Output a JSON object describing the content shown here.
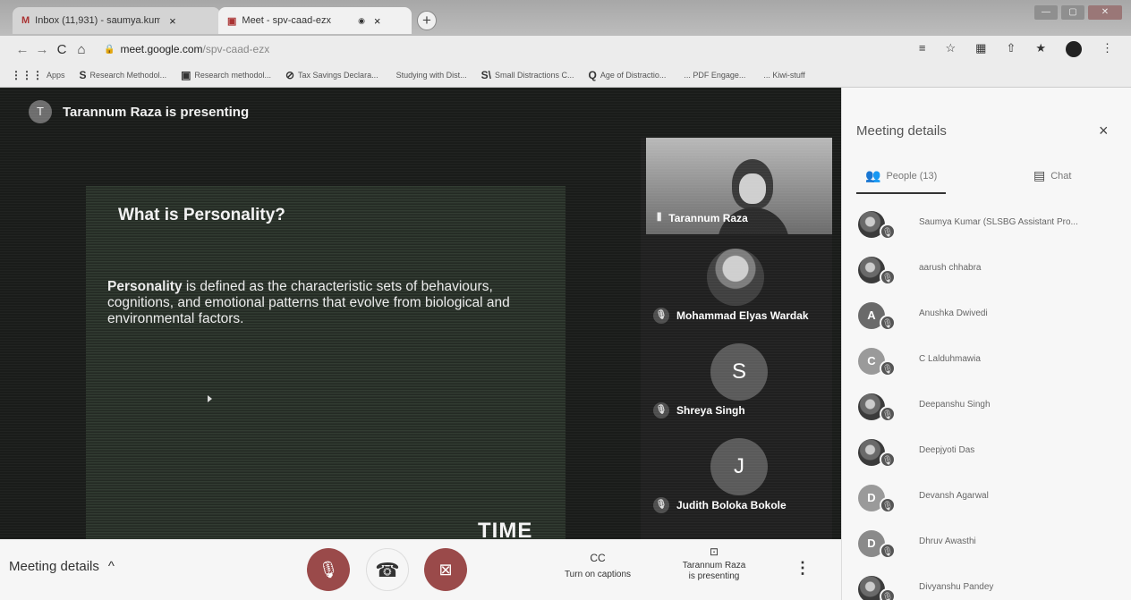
{
  "browser": {
    "tabs": [
      {
        "favicon": "M",
        "title": "Inbox (11,931) - saumya.kumar",
        "close": "×"
      },
      {
        "favicon": "▣",
        "title": "Meet - spv-caad-ezx",
        "record": "◉",
        "close": "×"
      }
    ],
    "new_tab": "+",
    "window_controls": [
      "—",
      "▢",
      "✕"
    ],
    "nav": {
      "back": "←",
      "forward": "→",
      "reload": "C",
      "home": "⌂"
    },
    "url_lock": "🔒",
    "url_host": "meet.google.com",
    "url_path": "/spv-caad-ezx",
    "bookmarks": [
      {
        "icon": "⋮⋮⋮",
        "label": "Apps"
      },
      {
        "icon": "S",
        "label": "Research Methodol..."
      },
      {
        "icon": "▣",
        "label": "Research methodol..."
      },
      {
        "icon": "⊘",
        "label": "Tax Savings Declara..."
      },
      {
        "icon": "",
        "label": "Studying with Dist..."
      },
      {
        "icon": "S\\",
        "label": "Small Distractions C..."
      },
      {
        "icon": "Q",
        "label": "Age of Distractio..."
      },
      {
        "icon": "",
        "label": "... PDF Engage..."
      },
      {
        "icon": "",
        "label": "... Kiwi-stuff"
      }
    ],
    "extension_icons": [
      "≡",
      "☆",
      "▦",
      "⇧",
      "★"
    ],
    "menu": "⋮"
  },
  "presenting": {
    "avatar_letter": "T",
    "text": "Tarannum Raza is presenting"
  },
  "slide": {
    "title": "What is Personality?",
    "body_bold": "Personality",
    "body_rest": " is defined as the characteristic sets of behaviours, cognitions, and emotional patterns that evolve from biological and environmental factors.",
    "footer": "TIME"
  },
  "tiles": [
    {
      "name": "Tarannum Raza",
      "kind": "video",
      "indicator": "⦀"
    },
    {
      "name": "Mohammad Elyas Wardak",
      "kind": "photo",
      "indicator": "🎙"
    },
    {
      "name": "Shreya Singh",
      "kind": "letter",
      "letter": "S",
      "indicator": "🎙"
    },
    {
      "name": "Judith Boloka Bokole",
      "kind": "letter",
      "letter": "J",
      "indicator": "🎙"
    }
  ],
  "controls": {
    "meeting_details": "Meeting details",
    "meeting_details_caret": "^",
    "mic_icon": "🎙",
    "hangup_icon": "☎",
    "camera_icon": "⊠",
    "captions_icon": "CC",
    "captions_label": "Turn on captions",
    "presenting_icon": "⊡",
    "presenting_label_1": "Tarannum Raza",
    "presenting_label_2": "is presenting",
    "more_icon": "⋮"
  },
  "panel": {
    "title": "Meeting details",
    "close": "×",
    "tab_people_icon": "👥",
    "tab_people": "People (13)",
    "tab_chat_icon": "▤",
    "tab_chat": "Chat",
    "participants": [
      {
        "avatar": "photo",
        "letter": "",
        "color": "#777777",
        "name": "Saumya Kumar (SLSBG Assistant Pro..."
      },
      {
        "avatar": "photo",
        "letter": "",
        "color": "#777777",
        "name": "aarush chhabra"
      },
      {
        "avatar": "letter",
        "letter": "A",
        "color": "#6a6a6a",
        "name": "Anushka Dwivedi"
      },
      {
        "avatar": "letter",
        "letter": "C",
        "color": "#9a9a9a",
        "name": "C Lalduhmawia"
      },
      {
        "avatar": "photo",
        "letter": "",
        "color": "#777777",
        "name": "Deepanshu Singh"
      },
      {
        "avatar": "photo",
        "letter": "",
        "color": "#777777",
        "name": "Deepjyoti Das"
      },
      {
        "avatar": "letter",
        "letter": "D",
        "color": "#9a9a9a",
        "name": "Devansh Agarwal"
      },
      {
        "avatar": "letter",
        "letter": "D",
        "color": "#8a8a8a",
        "name": "Dhruv Awasthi"
      },
      {
        "avatar": "photo",
        "letter": "",
        "color": "#777777",
        "name": "Divyanshu Pandey"
      }
    ],
    "mute_icon": "🎙"
  }
}
